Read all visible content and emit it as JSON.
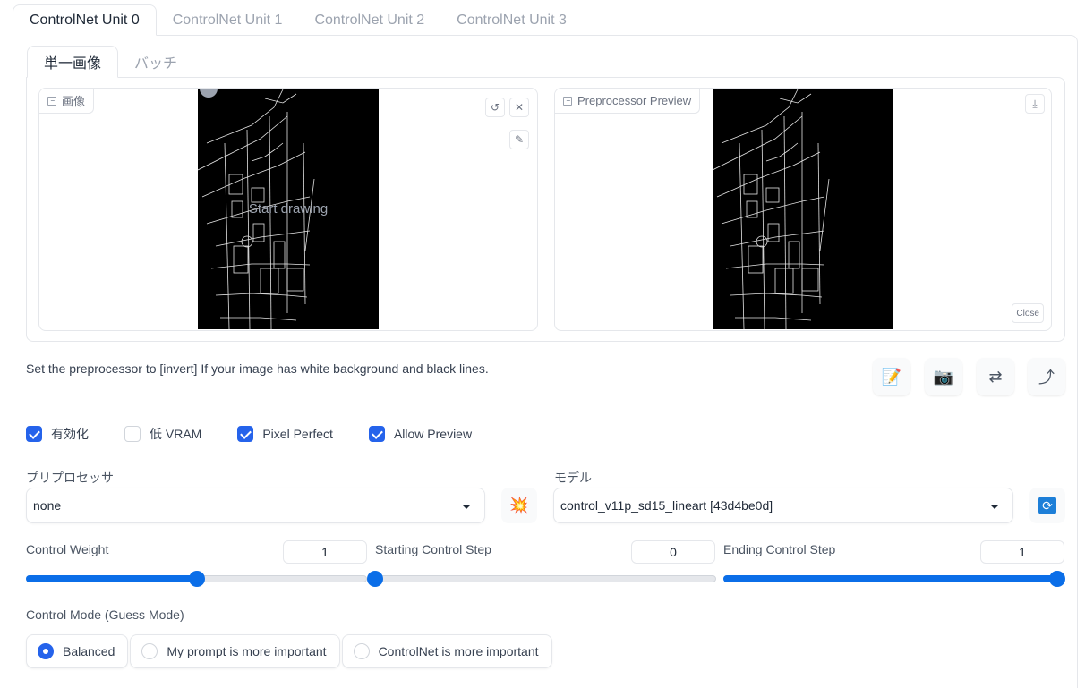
{
  "top_tabs": [
    "ControlNet Unit 0",
    "ControlNet Unit 1",
    "ControlNet Unit 2",
    "ControlNet Unit 3"
  ],
  "inner_tabs": [
    "単一画像",
    "バッチ"
  ],
  "image_box": {
    "label": "画像",
    "overlay_text": "Start drawing"
  },
  "preview_box": {
    "label": "Preprocessor Preview",
    "close_label": "Close"
  },
  "hint": "Set the preprocessor to [invert] If your image has white background and black lines.",
  "checkboxes": [
    {
      "label": "有効化",
      "checked": true
    },
    {
      "label": "低 VRAM",
      "checked": false
    },
    {
      "label": "Pixel Perfect",
      "checked": true
    },
    {
      "label": "Allow Preview",
      "checked": true
    }
  ],
  "preprocessor": {
    "label": "プリプロセッサ",
    "value": "none"
  },
  "model": {
    "label": "モデル",
    "value": "control_v11p_sd15_lineart [43d4be0d]"
  },
  "sliders": [
    {
      "label": "Control Weight",
      "value": "1",
      "fraction": 0.5
    },
    {
      "label": "Starting Control Step",
      "value": "0",
      "fraction": 0.0
    },
    {
      "label": "Ending Control Step",
      "value": "1",
      "fraction": 1.0
    }
  ],
  "control_mode": {
    "label": "Control Mode (Guess Mode)",
    "options": [
      "Balanced",
      "My prompt is more important",
      "ControlNet is more important"
    ],
    "selected": "Balanced"
  },
  "icons": {
    "edit": "edit-note-icon",
    "camera": "camera-icon",
    "swap": "swap-arrows-icon",
    "send": "curved-arrow-icon",
    "preprocess": "explosion-icon",
    "refresh": "refresh-icon"
  },
  "colors": {
    "accent": "#2563eb",
    "slider": "#0b6ee8"
  }
}
